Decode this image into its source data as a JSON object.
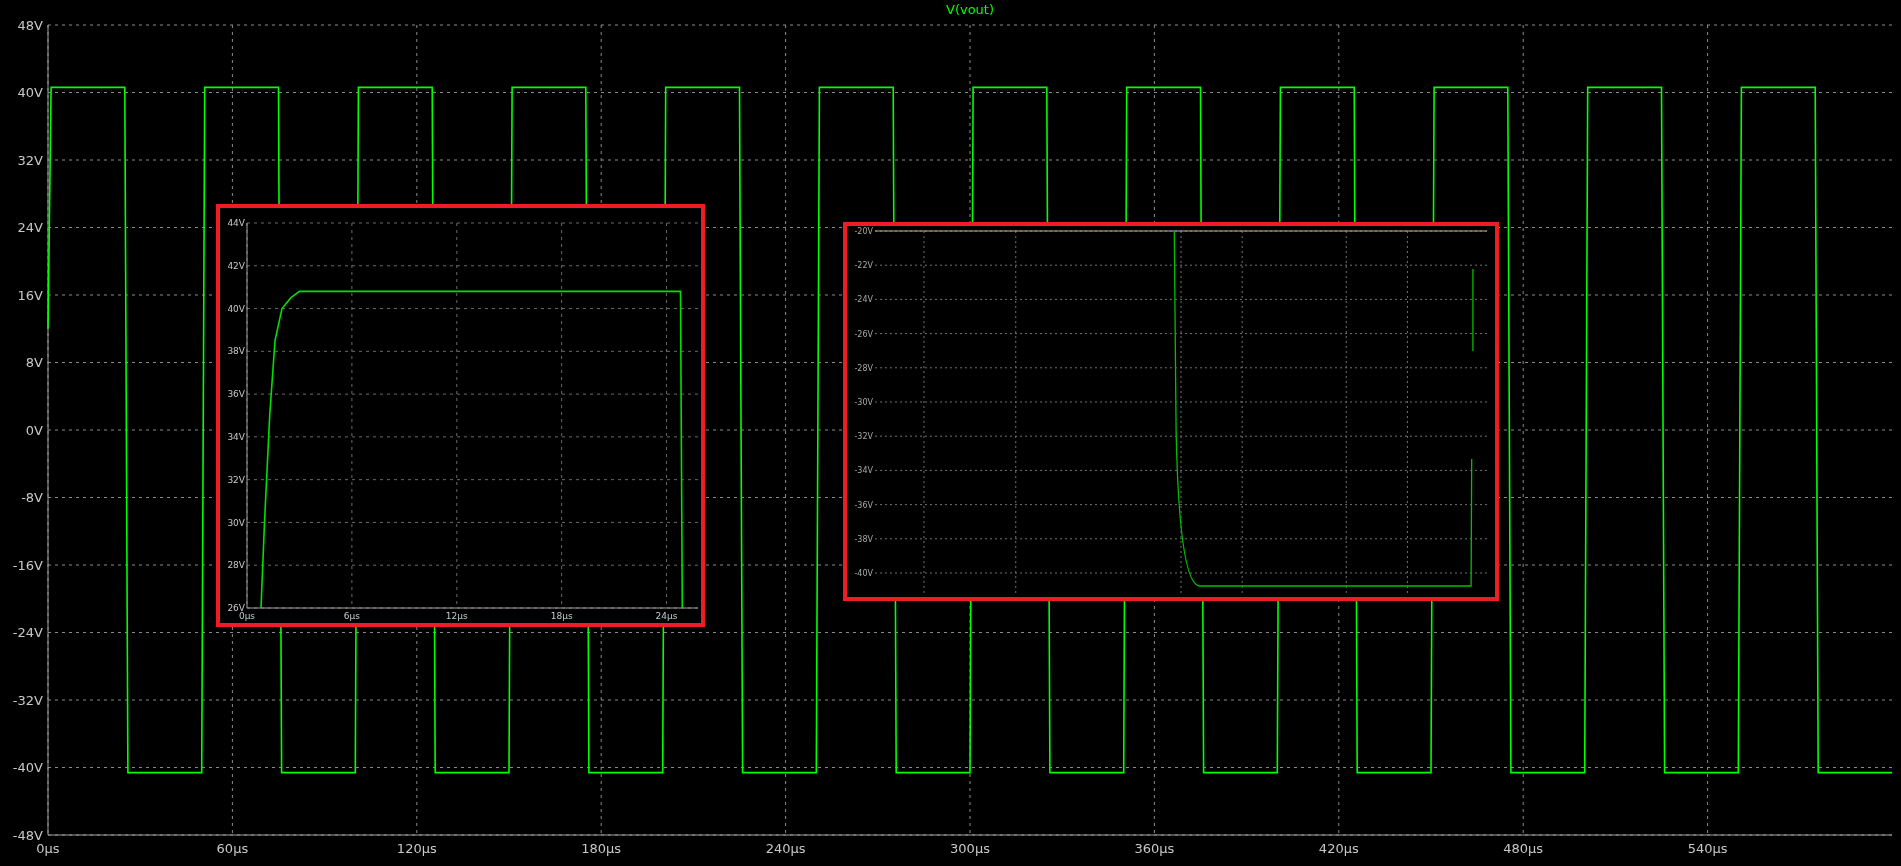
{
  "main_plot": {
    "chart_data": {
      "type": "line",
      "grid": true,
      "x": [
        0,
        1,
        25,
        26,
        50,
        51,
        75,
        76,
        100,
        101,
        125,
        126,
        150,
        151,
        175,
        176,
        200,
        201,
        225,
        226,
        250,
        251,
        275,
        276,
        300,
        301,
        325,
        326,
        350,
        351,
        375,
        376,
        400,
        401,
        425,
        426,
        450,
        451,
        475,
        476,
        500,
        501,
        525,
        526,
        550,
        551,
        575,
        576,
        600
      ],
      "series": [
        {
          "name": "V(vout)",
          "color": "#00ff00",
          "values": [
            12,
            40.6,
            40.6,
            -40.6,
            -40.6,
            40.6,
            40.6,
            -40.6,
            -40.6,
            40.6,
            40.6,
            -40.6,
            -40.6,
            40.6,
            40.6,
            -40.6,
            -40.6,
            40.6,
            40.6,
            -40.6,
            -40.6,
            40.6,
            40.6,
            -40.6,
            -40.6,
            40.6,
            40.6,
            -40.6,
            -40.6,
            40.6,
            40.6,
            -40.6,
            -40.6,
            40.6,
            40.6,
            -40.6,
            -40.6,
            40.6,
            40.6,
            -40.6,
            -40.6,
            40.6,
            40.6,
            -40.6,
            -40.6,
            40.6,
            40.6,
            -40.6,
            -40.6
          ]
        }
      ],
      "xlim": [
        0,
        600
      ],
      "ylim": [
        -48,
        48
      ],
      "xticks": [
        {
          "value": 0,
          "label": "0µs"
        },
        {
          "value": 60,
          "label": "60µs"
        },
        {
          "value": 120,
          "label": "120µs"
        },
        {
          "value": 180,
          "label": "180µs"
        },
        {
          "value": 240,
          "label": "240µs"
        },
        {
          "value": 300,
          "label": "300µs"
        },
        {
          "value": 360,
          "label": "360µs"
        },
        {
          "value": 420,
          "label": "420µs"
        },
        {
          "value": 480,
          "label": "480µs"
        },
        {
          "value": 540,
          "label": "540µs"
        }
      ],
      "yticks": [
        {
          "value": 48,
          "label": "48V"
        },
        {
          "value": 40,
          "label": "40V"
        },
        {
          "value": 32,
          "label": "32V"
        },
        {
          "value": 24,
          "label": "24V"
        },
        {
          "value": 16,
          "label": "16V"
        },
        {
          "value": 8,
          "label": "8V"
        },
        {
          "value": 0,
          "label": "0V"
        },
        {
          "value": -8,
          "label": "-8V"
        },
        {
          "value": -16,
          "label": "-16V"
        },
        {
          "value": -24,
          "label": "-24V"
        },
        {
          "value": -32,
          "label": "-32V"
        },
        {
          "value": -40,
          "label": "-40V"
        },
        {
          "value": -48,
          "label": "-48V"
        }
      ]
    }
  },
  "insets": [
    {
      "kind": "chart",
      "chart_data": {
        "type": "line",
        "grid": true,
        "x": [
          0.8,
          1.0,
          1.3,
          1.6,
          2.0,
          2.5,
          3.0,
          4.0,
          24.8,
          24.9
        ],
        "series": [
          {
            "color": "#00e000",
            "values": [
              26,
              30,
              35,
              38.5,
              40,
              40.5,
              40.8,
              40.8,
              40.8,
              26
            ]
          }
        ],
        "xlim": [
          0,
          25.8
        ],
        "ylim": [
          26,
          44
        ],
        "xticks": [
          {
            "value": 0,
            "label": "0µs"
          },
          {
            "value": 6,
            "label": "6µs"
          },
          {
            "value": 12,
            "label": "12µs"
          },
          {
            "value": 18,
            "label": "18µs"
          },
          {
            "value": 24,
            "label": "24µs"
          }
        ],
        "yticks": [
          {
            "value": 44,
            "label": "44V"
          },
          {
            "value": 42,
            "label": "42V"
          },
          {
            "value": 40,
            "label": "40V"
          },
          {
            "value": 38,
            "label": "38V"
          },
          {
            "value": 36,
            "label": "36V"
          },
          {
            "value": 34,
            "label": "34V"
          },
          {
            "value": 32,
            "label": "32V"
          },
          {
            "value": 30,
            "label": "30V"
          },
          {
            "value": 28,
            "label": "28V"
          },
          {
            "value": 26,
            "label": "26V"
          }
        ]
      }
    },
    {
      "kind": "picture",
      "y_tick_labels": [
        "-20V",
        "-22V",
        "-24V",
        "-26V",
        "-28V",
        "-30V",
        "-32V",
        "-34V",
        "-36V",
        "-38V",
        "-40V"
      ]
    }
  ]
}
